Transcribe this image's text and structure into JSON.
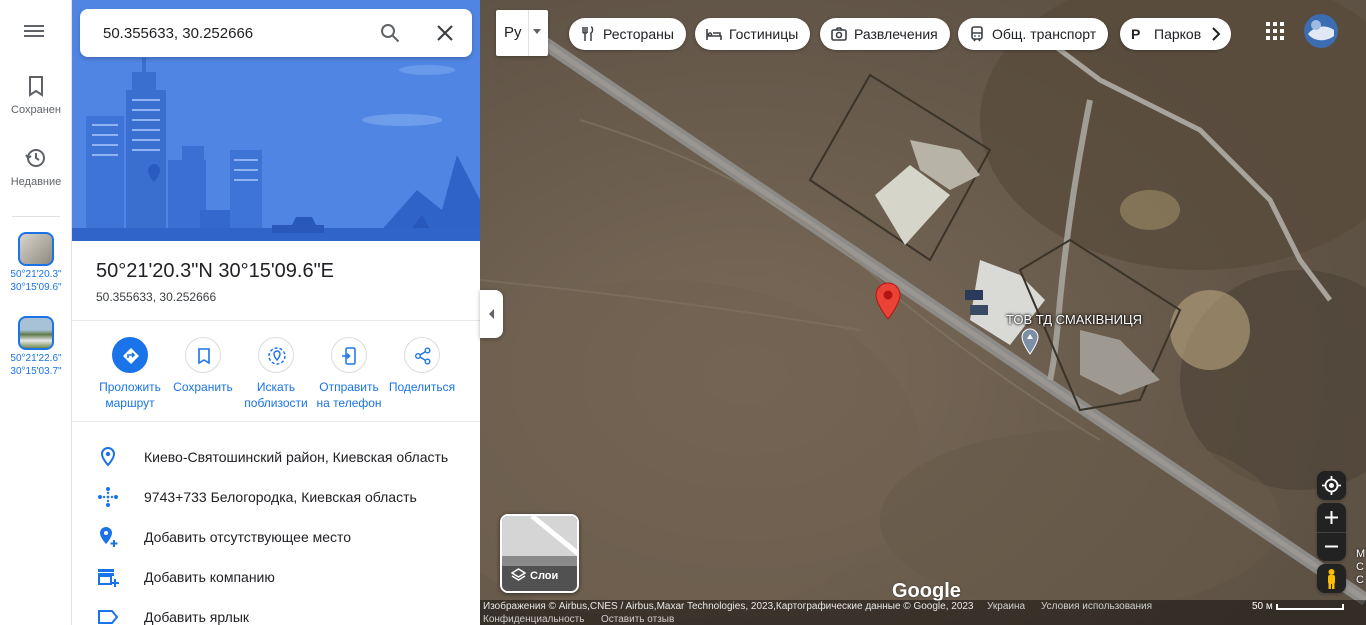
{
  "rail": {
    "menu_icon": "hamburger-menu-icon",
    "saved_label": "Сохранен",
    "recent_label": "Недавние",
    "recent_items": [
      {
        "lat": "50°21'20.3\"",
        "lng": "30°15'09.6\""
      },
      {
        "lat": "50°21'22.6\"",
        "lng": "30°15'03.7\""
      }
    ]
  },
  "search": {
    "value": "50.355633, 30.252666",
    "placeholder": ""
  },
  "place": {
    "title": "50°21'20.3\"N 30°15'09.6\"E",
    "subtitle": "50.355633, 30.252666"
  },
  "actions": [
    {
      "label_line1": "Проложить",
      "label_line2": "маршрут",
      "icon": "directions-icon"
    },
    {
      "label_line1": "Сохранить",
      "label_line2": "",
      "icon": "bookmark-icon"
    },
    {
      "label_line1": "Искать",
      "label_line2": "поблизости",
      "icon": "nearby-icon"
    },
    {
      "label_line1": "Отправить",
      "label_line2": "на телефон",
      "icon": "send-to-phone-icon"
    },
    {
      "label_line1": "Поделиться",
      "label_line2": "",
      "icon": "share-icon"
    }
  ],
  "info": [
    {
      "text": "Киево-Святошинский район, Киевская область",
      "icon": "location-pin-icon"
    },
    {
      "text": "9743+733 Белогородка, Киевская область",
      "icon": "plus-code-icon"
    },
    {
      "text": "Добавить отсутствующее место",
      "icon": "add-place-icon"
    },
    {
      "text": "Добавить компанию",
      "icon": "add-business-icon"
    },
    {
      "text": "Добавить ярлык",
      "icon": "label-icon"
    }
  ],
  "map": {
    "lang_value": "Ру",
    "chips": [
      {
        "label": "Рестораны",
        "icon": "restaurant-icon"
      },
      {
        "label": "Гостиницы",
        "icon": "hotel-icon"
      },
      {
        "label": "Развлечения",
        "icon": "camera-icon"
      },
      {
        "label": "Общ. транспорт",
        "icon": "transit-icon"
      },
      {
        "label": "Парков",
        "icon": "parking-icon"
      }
    ],
    "poi_label": "ТОВ ТД СМАКІВНИЦЯ",
    "layers_label": "Слои",
    "logo": "Google",
    "edge_text": "М С С",
    "footer": {
      "attribution": "Изображения © Airbus,CNES / Airbus,Maxar Technologies, 2023,Картографические данные © Google, 2023",
      "country": "Украина",
      "terms": "Условия использования",
      "scale": "50 м",
      "privacy": "Конфиденциальность",
      "feedback": "Оставить отзыв"
    }
  },
  "colors": {
    "accent": "#1a73e8",
    "hero": "#4285f4",
    "marker": "#ea4335"
  }
}
